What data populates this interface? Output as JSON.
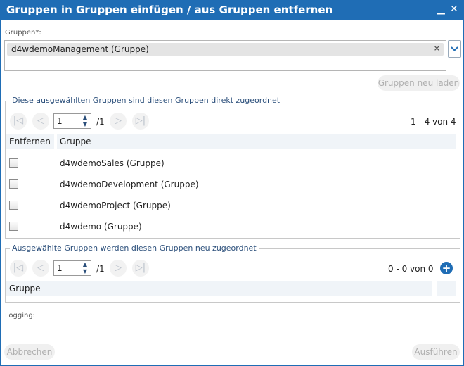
{
  "window": {
    "title": "Gruppen in Gruppen einfügen / aus Gruppen entfernen",
    "minimize_icon": "minus-icon",
    "close_icon": "close-icon"
  },
  "groups_field": {
    "label": "Gruppen*:",
    "selected_tag": "d4wdemoManagement (Gruppe)",
    "tag_remove": "×",
    "dropdown_icon": "chevron-down-icon",
    "reload_button": "Gruppen neu laden"
  },
  "assigned_section": {
    "legend": "Diese ausgewählten Gruppen sind diesen Gruppen direkt zugeordnet",
    "pager": {
      "first": "|◁",
      "prev": "◁",
      "page_value": "1",
      "of_pages": "/1",
      "next": "▷",
      "last": "▷|",
      "range": "1 - 4 von 4"
    },
    "columns": [
      "Entfernen",
      "Gruppe"
    ],
    "rows": [
      {
        "group": "d4wdemoSales (Gruppe)"
      },
      {
        "group": "d4wdemoDevelopment (Gruppe)"
      },
      {
        "group": "d4wdemoProject (Gruppe)"
      },
      {
        "group": "d4wdemo (Gruppe)"
      }
    ]
  },
  "new_section": {
    "legend": "Ausgewählte Gruppen werden diesen Gruppen neu zugeordnet",
    "pager": {
      "first": "|◁",
      "prev": "◁",
      "page_value": "1",
      "of_pages": "/1",
      "next": "▷",
      "last": "▷|",
      "range": "0 - 0 von 0"
    },
    "add_icon": "plus-circle-icon",
    "columns": [
      "Gruppe"
    ]
  },
  "logging_label": "Logging:",
  "footer": {
    "cancel": "Abbrechen",
    "execute": "Ausführen"
  }
}
